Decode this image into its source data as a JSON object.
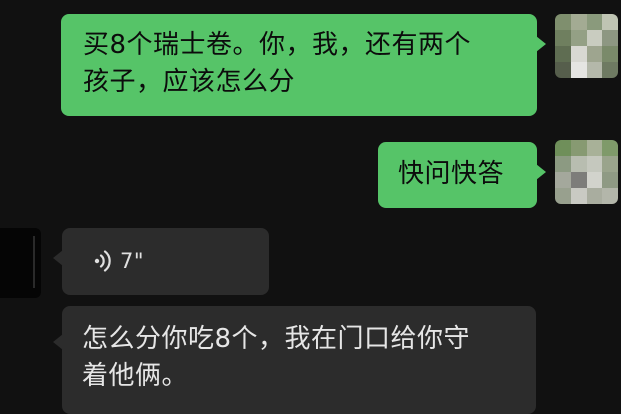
{
  "colors": {
    "background": "#111111",
    "outgoing_bubble": "#56c468",
    "incoming_bubble": "#2c2c2c",
    "incoming_text": "#e6e6e6"
  },
  "messages": [
    {
      "sender": "me",
      "text_lines": [
        "买8个瑞士卷。你，我，还有两个",
        "孩子，应该怎么分"
      ]
    },
    {
      "sender": "me",
      "text_lines": [
        "快问快答"
      ]
    },
    {
      "sender": "other",
      "type": "voice",
      "icon": "voice-wave-icon",
      "duration": "7\""
    },
    {
      "sender": "other",
      "text_lines": [
        "怎么分你吃8个，我在门口给你守",
        "着他俩。"
      ]
    }
  ]
}
